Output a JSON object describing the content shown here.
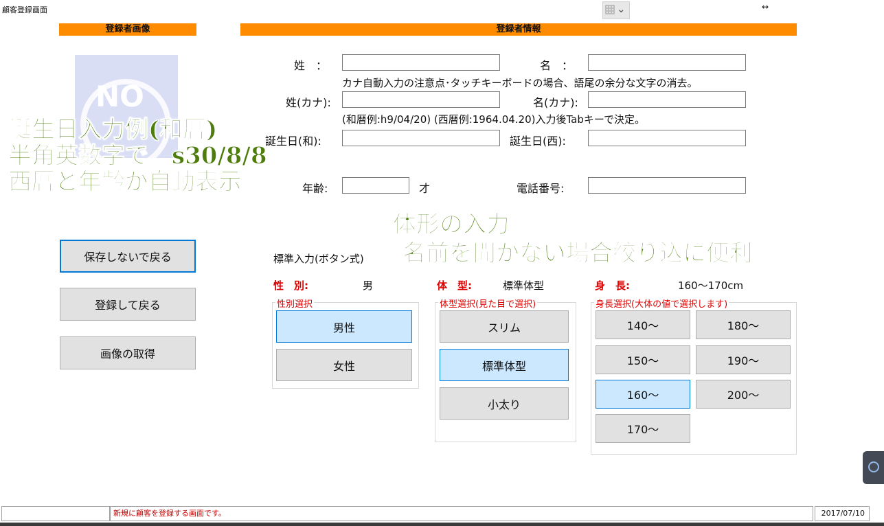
{
  "window": {
    "title": "顧客登録画面",
    "toolbar_icon": "grid-dropdown-icon",
    "resize_icon": "resize-arrows-icon",
    "resize_glyph": "↔"
  },
  "sections": {
    "image_header": "登録者画像",
    "info_header": "登録者情報",
    "no_image_text": "NO"
  },
  "form": {
    "last_name_label": "姓　：",
    "first_name_label": "名　：",
    "kana_note": "カナ自動入力の注意点･タッチキーボードの場合、語尾の余分な文字の消去。",
    "last_kana_label": "姓(カナ):",
    "first_kana_label": "名(カナ):",
    "date_note": "(和暦例:h9/04/20) (西暦例:1964.04.20)入力後Tabキーで決定。",
    "birth_wa_label": "誕生日(和):",
    "birth_sei_label": "誕生日(西):",
    "age_label": "年齢:",
    "age_unit": "才",
    "phone_label": "電話番号:",
    "values": {
      "last_name": "",
      "first_name": "",
      "last_kana": "",
      "first_kana": "",
      "birth_wa": "",
      "birth_sei": "",
      "age": "",
      "phone": ""
    }
  },
  "overlay": {
    "birthday_lines": [
      "誕生日入力例(和暦)",
      "半角英数字で　s30/8/8",
      "西暦と年齢が自動表示"
    ],
    "body_lines": [
      "体形の入力",
      "名前を聞かない場合絞り込に便利"
    ]
  },
  "actions": {
    "back_no_save": "保存しないで戻る",
    "register_back": "登録して戻る",
    "get_image": "画像の取得"
  },
  "standard_input": {
    "title": "標準入力(ボタン式)",
    "gender_label": "性　別:",
    "gender_value": "男",
    "body_label": "体　型:",
    "body_value": "標準体型",
    "height_label": "身　長:",
    "height_value": "160～170cm"
  },
  "gender_group": {
    "title": "性別選択",
    "options": [
      "男性",
      "女性"
    ],
    "selected": "男性"
  },
  "body_group": {
    "title": "体型選択(見た目で選択)",
    "options": [
      "スリム",
      "標準体型",
      "小太り"
    ],
    "selected": "標準体型"
  },
  "height_group": {
    "title": "身長選択(大体の値で選択します)",
    "options": [
      "140～",
      "180～",
      "150～",
      "190～",
      "160～",
      "200～",
      "170～"
    ],
    "selected": "160～"
  },
  "status_bar": {
    "left": "",
    "message": "新規に顧客を登録する画面です。",
    "date": "2017/07/10"
  },
  "colors": {
    "section_header": "#ff8c00",
    "overlay_green": "#4e7d0e",
    "selected_button": "#cce8ff",
    "accent_blue": "#0078d7",
    "label_red": "#e00000"
  }
}
